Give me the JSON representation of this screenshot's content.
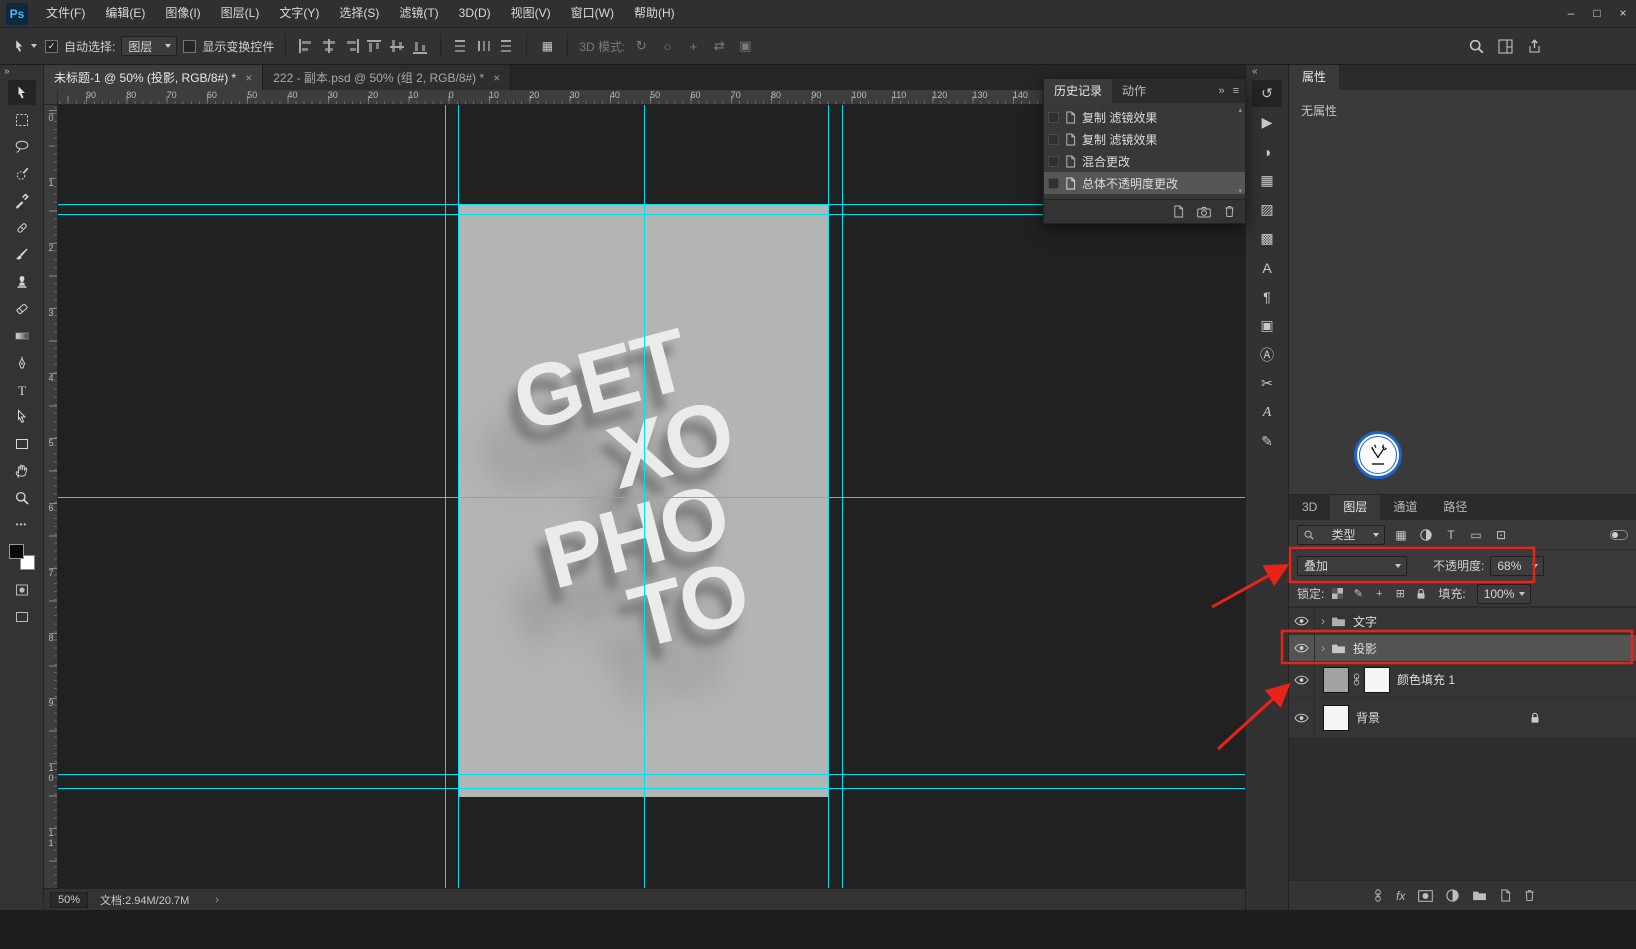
{
  "titlebar": {
    "app_badge": "Ps",
    "menus": [
      "文件(F)",
      "编辑(E)",
      "图像(I)",
      "图层(L)",
      "文字(Y)",
      "选择(S)",
      "滤镜(T)",
      "3D(D)",
      "视图(V)",
      "窗口(W)",
      "帮助(H)"
    ],
    "window_controls": {
      "minimize": "–",
      "maximize": "□",
      "close": "×"
    }
  },
  "options_bar": {
    "auto_select_label": "自动选择:",
    "auto_select_value": "图层",
    "show_transform_label": "显示变换控件",
    "mode_3d_label": "3D 模式:"
  },
  "document_tabs": {
    "close_glyph": "×",
    "tabs": [
      {
        "title": "未标题-1 @ 50% (投影, RGB/8#) *"
      },
      {
        "title": "222 - 副本.psd @ 50% (组 2, RGB/8#) *"
      }
    ]
  },
  "panel_collapse": {
    "left": "»",
    "right": "«",
    "history": "»"
  },
  "rulers": {
    "horizontal": [
      "90",
      "80",
      "70",
      "60",
      "50",
      "40",
      "30",
      "20",
      "10",
      "0",
      "10",
      "20",
      "30",
      "40",
      "50",
      "60",
      "70",
      "80",
      "90",
      "100",
      "110",
      "120",
      "130",
      "140"
    ],
    "vertical": [
      "0",
      "1",
      "2",
      "3",
      "4",
      "5",
      "6",
      "7",
      "8",
      "9",
      "10",
      "11"
    ]
  },
  "canvas": {
    "poster_lines": [
      "GET",
      "XO",
      "PHO",
      "TO"
    ]
  },
  "history_panel": {
    "tabs": [
      "历史记录",
      "动作"
    ],
    "entries": [
      "复制 滤镜效果",
      "复制 滤镜效果",
      "混合更改",
      "总体不透明度更改"
    ],
    "selected_index": 3,
    "menu_glyph": "≡"
  },
  "properties_panel": {
    "tab": "属性",
    "empty_text": "无属性"
  },
  "panel_tabs": [
    "3D",
    "图层",
    "通道",
    "路径"
  ],
  "layers_panel": {
    "filter_label": "类型",
    "blend_mode": "叠加",
    "opacity_label": "不透明度:",
    "opacity_value": "68%",
    "lock_label": "锁定:",
    "fill_label": "填充:",
    "fill_value": "100%",
    "fx_label": "fx",
    "layers": [
      {
        "name": "文字",
        "kind": "group"
      },
      {
        "name": "投影",
        "kind": "group",
        "selected": true
      },
      {
        "name": "颜色填充 1",
        "kind": "fill"
      },
      {
        "name": "背景",
        "kind": "background",
        "locked": true
      }
    ]
  },
  "status_bar": {
    "zoom": "50%",
    "document_info": "文档:2.94M/20.7M",
    "chevron": "›"
  },
  "icon_glyphs": {
    "history": "↺",
    "actions": "▶",
    "color": "◑",
    "swatches": "▦",
    "gradients": "▨",
    "patterns": "▩",
    "character": "A",
    "paragraph": "¶",
    "clone_source": "▣",
    "character_styles": "Ⓐ",
    "scissors": "✂",
    "glyphs": "A",
    "brush_settings": "✎",
    "ellipsis": "•••",
    "check": "✓",
    "scroll_up": "▴",
    "scroll_down": "▾",
    "lock_move": "+",
    "lock_artboard": "⊞",
    "lock_brush": "✎",
    "filter_image": "▦",
    "filter_type": "T",
    "filter_shape": "▭",
    "filter_smart": "⊡",
    "mode3d": [
      "↻",
      "○",
      "+",
      "⇄",
      "▣"
    ]
  },
  "colors": {
    "annotation_red": "#e8231a",
    "guide_cyan": "#00e1f0"
  }
}
